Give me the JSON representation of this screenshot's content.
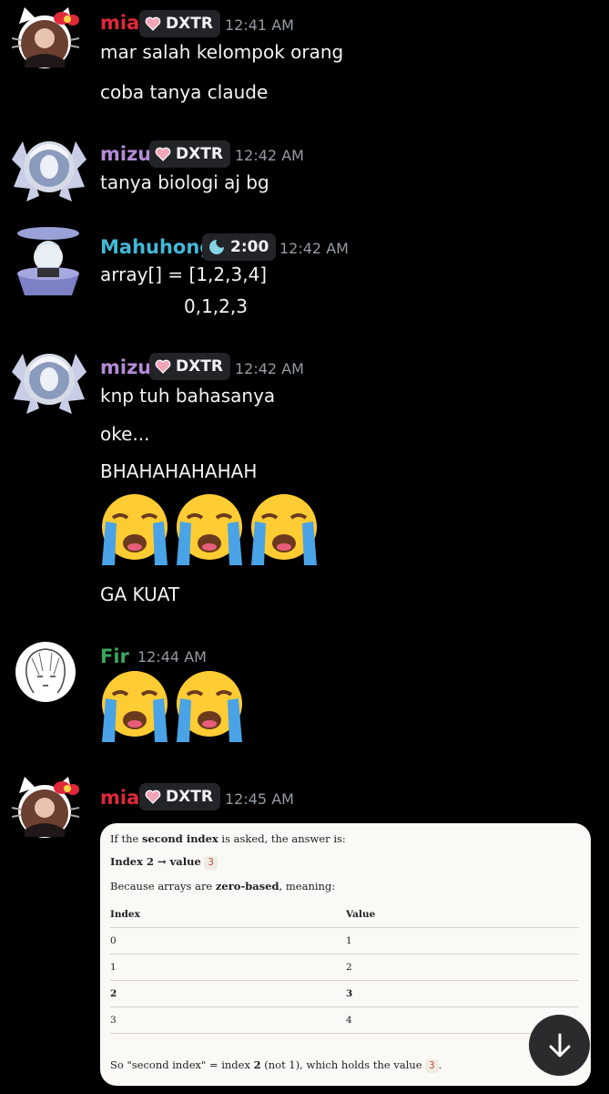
{
  "messages": [
    {
      "author": "mia",
      "author_color": "#e0283b",
      "tag": "DXTR",
      "time": "12:41 AM",
      "lines": [
        "mar salah kelompok orang",
        "coba tanya claude"
      ]
    },
    {
      "author": "mizu",
      "author_color": "#b38bd6",
      "tag": "DXTR",
      "time": "12:42 AM",
      "lines": [
        "tanya biologi aj bg"
      ]
    },
    {
      "author": "Mahuhong",
      "author_color": "#43b8d6",
      "tag": "2:00",
      "time": "12:42 AM",
      "lines": [
        "array[] = [1,2,3,4]",
        "0,1,2,3"
      ]
    },
    {
      "author": "mizu",
      "author_color": "#b38bd6",
      "tag": "DXTR",
      "time": "12:42 AM",
      "lines": [
        "knp tuh bahasanya",
        "oke...",
        "BHAHAHAHAHAH",
        "GA KUAT"
      ],
      "emojis": [
        "loudly-crying-face",
        "loudly-crying-face",
        "loudly-crying-face"
      ]
    },
    {
      "author": "Fir",
      "author_color": "#3ba55d",
      "time": "12:44 AM",
      "emojis": [
        "loudly-crying-face",
        "loudly-crying-face"
      ]
    },
    {
      "author": "mia",
      "author_color": "#e0283b",
      "tag": "DXTR",
      "time": "12:45 AM"
    }
  ],
  "attachment": {
    "intro_prefix": "If the ",
    "intro_bold": "second index",
    "intro_suffix": " is asked, the answer is:",
    "answer_bold": "Index 2 → value",
    "answer_code": "3",
    "because_prefix": "Because arrays are ",
    "because_bold": "zero-based",
    "because_suffix": ", meaning:",
    "table": {
      "headers": [
        "Index",
        "Value"
      ],
      "rows": [
        [
          "0",
          "1"
        ],
        [
          "1",
          "2"
        ],
        [
          "2",
          "3"
        ],
        [
          "3",
          "4"
        ]
      ],
      "bold_row_index": 2
    },
    "summary_prefix": "So \"second index\" = index ",
    "summary_bold": "2",
    "summary_mid": " (not 1), which holds the value ",
    "summary_code": "3",
    "summary_suffix": "."
  },
  "colors": {
    "background": "#000000",
    "text": "#f2f3f5",
    "timestamp": "#949ba4",
    "tag_bg": "#232428",
    "card_bg": "#faf9f5"
  },
  "icons": {
    "tag": "heart-icon",
    "tag_mahuhong": "crescent-moon-icon",
    "scroll": "arrow-down-icon"
  }
}
